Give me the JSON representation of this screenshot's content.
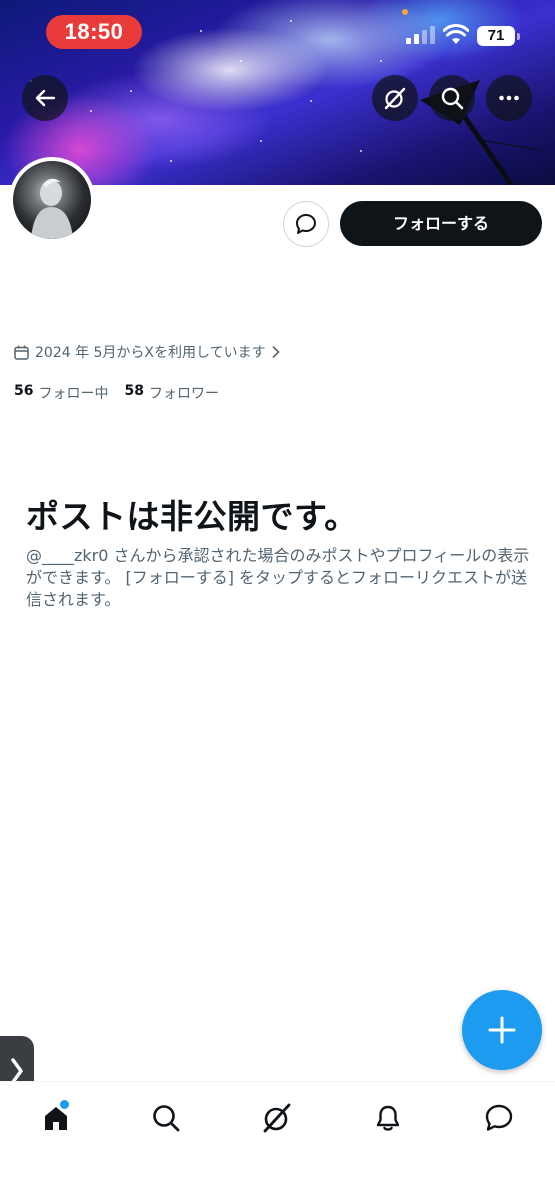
{
  "status_bar": {
    "time": "18:50",
    "battery": "71",
    "icons": [
      "cellular-signal-icon",
      "wifi-icon",
      "battery-icon"
    ]
  },
  "header": {
    "icons": [
      "back-arrow-icon",
      "grok-icon",
      "search-icon",
      "more-icon"
    ]
  },
  "profile": {
    "follow_label": "フォローする",
    "joined": "2024 年 5月からXを利用しています",
    "following_count": "56",
    "following_label": "フォロー中",
    "followers_count": "58",
    "followers_label": "フォロワー"
  },
  "private_notice": {
    "title": "ポストは非公開です。",
    "description": "@____zkr0 さんから承認された場合のみポストやプロフィールの表示ができます。 [フォローする] をタップするとフォローリクエストが送信されます。"
  },
  "bottom_nav": {
    "items": [
      "home-icon",
      "search-icon",
      "grok-icon",
      "notifications-icon",
      "messages-icon"
    ]
  },
  "colors": {
    "accent": "#1d9bf0",
    "text_primary": "#0f1419",
    "text_secondary": "#536471",
    "status_pill": "#ea3b3b"
  }
}
